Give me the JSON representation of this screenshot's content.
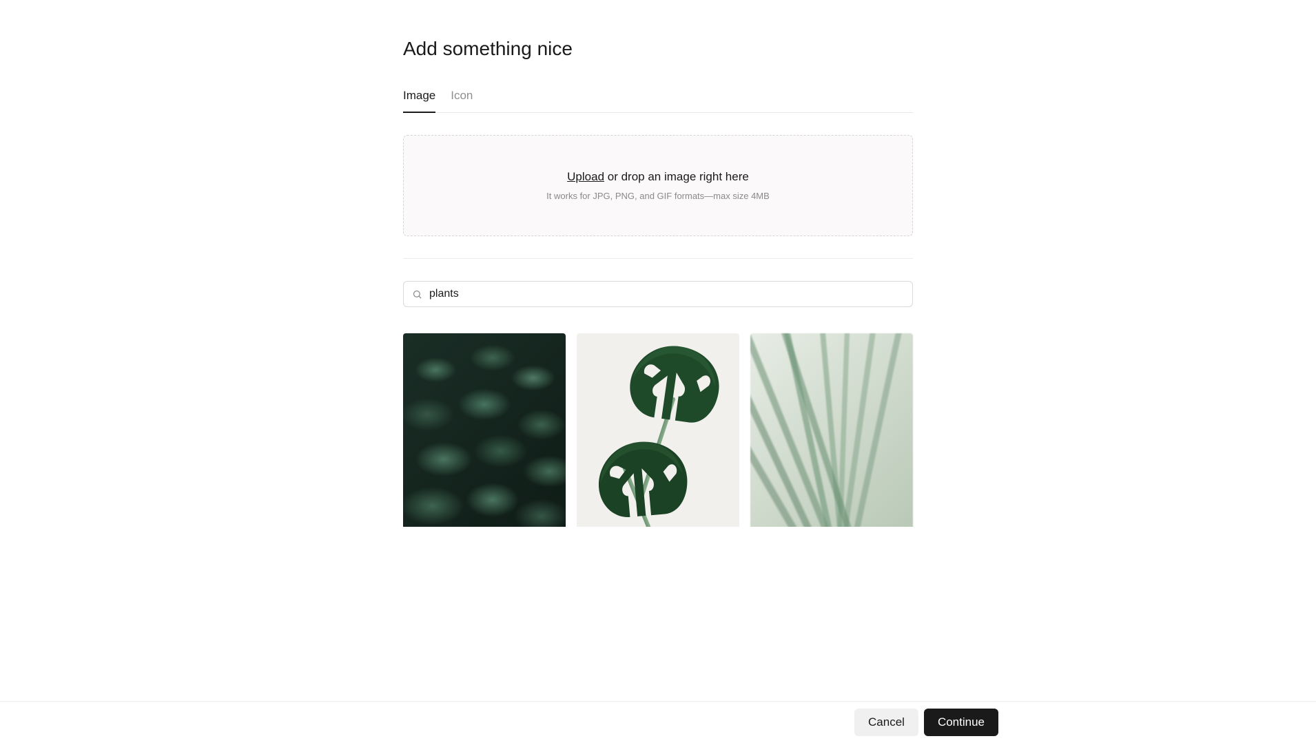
{
  "page": {
    "title": "Add something nice"
  },
  "tabs": {
    "image": "Image",
    "icon": "Icon",
    "active": "image"
  },
  "dropzone": {
    "upload_link": "Upload",
    "main_suffix": " or drop an image right here",
    "sub": "It works for JPG, PNG, and GIF formats—max size 4MB"
  },
  "search": {
    "value": "plants",
    "placeholder": "Search"
  },
  "results": [
    {
      "alt": "dark-green-leaves"
    },
    {
      "alt": "monstera-plant"
    },
    {
      "alt": "palm-fronds"
    }
  ],
  "footer": {
    "cancel": "Cancel",
    "continue": "Continue"
  }
}
